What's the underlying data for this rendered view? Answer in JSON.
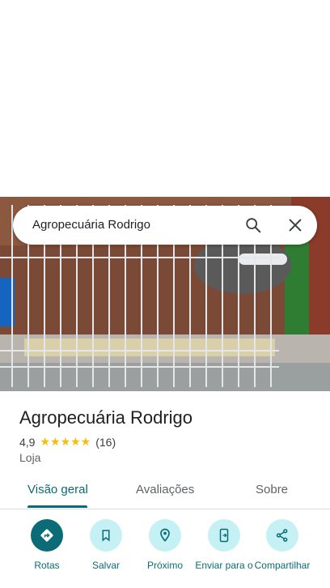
{
  "search": {
    "query": "Agropecuária Rodrigo"
  },
  "place": {
    "name": "Agropecuária Rodrigo",
    "rating": "4,9",
    "stars": "★★★★★",
    "review_count": "(16)",
    "category": "Loja"
  },
  "tabs": [
    {
      "label": "Visão geral",
      "active": true
    },
    {
      "label": "Avaliações",
      "active": false
    },
    {
      "label": "Sobre",
      "active": false
    }
  ],
  "actions": [
    {
      "label": "Rotas",
      "icon": "directions-icon"
    },
    {
      "label": "Salvar",
      "icon": "bookmark-icon"
    },
    {
      "label": "Próximo",
      "icon": "nearby-icon"
    },
    {
      "label": "Enviar para o",
      "icon": "send-to-phone-icon"
    },
    {
      "label": "Compartilhar",
      "icon": "share-icon"
    }
  ],
  "colors": {
    "accent": "#0b6b76",
    "action_bg": "#c5f1f4",
    "star": "#fbbc04"
  }
}
